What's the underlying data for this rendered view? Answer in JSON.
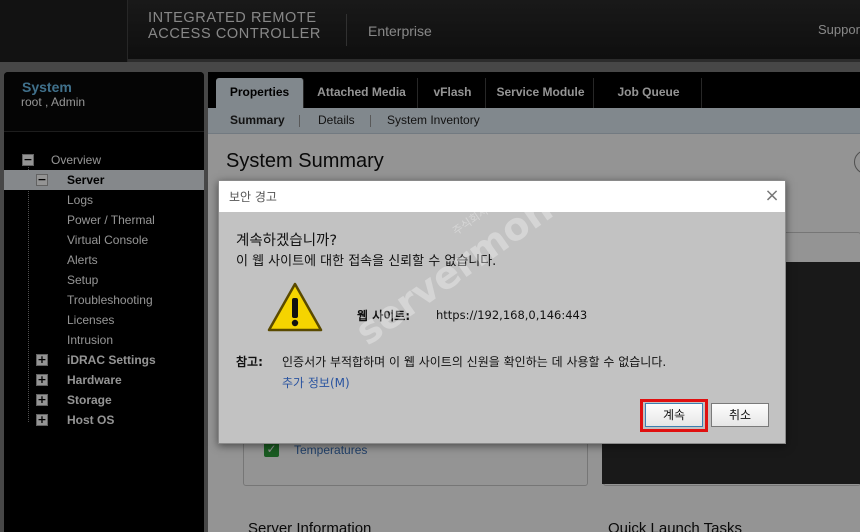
{
  "header": {
    "brand_line1": "INTEGRATED REMOTE",
    "brand_line2": "ACCESS CONTROLLER",
    "edition": "Enterprise",
    "support": "Support"
  },
  "sidebar": {
    "title": "System",
    "user": "root , Admin",
    "tree": [
      {
        "label": "Overview",
        "toggle": "−"
      },
      {
        "label": "Server",
        "toggle": "−"
      },
      {
        "label": "Logs"
      },
      {
        "label": "Power / Thermal"
      },
      {
        "label": "Virtual Console"
      },
      {
        "label": "Alerts"
      },
      {
        "label": "Setup"
      },
      {
        "label": "Troubleshooting"
      },
      {
        "label": "Licenses"
      },
      {
        "label": "Intrusion"
      },
      {
        "label": "iDRAC Settings",
        "toggle": "+"
      },
      {
        "label": "Hardware",
        "toggle": "+"
      },
      {
        "label": "Storage",
        "toggle": "+"
      },
      {
        "label": "Host OS",
        "toggle": "+"
      }
    ]
  },
  "tabs": [
    "Properties",
    "Attached Media",
    "vFlash",
    "Service Module",
    "Job Queue"
  ],
  "subtabs": [
    "Summary",
    "Details",
    "System Inventory"
  ],
  "page": {
    "title": "System Summary",
    "temperatures_link": "Temperatures",
    "server_info": "Server Information",
    "quick_launch": "Quick Launch Tasks"
  },
  "dialog": {
    "title": "보안 경고",
    "close": "×",
    "heading": "계속하겠습니까?",
    "description": "이 웹 사이트에 대한 접속을 신뢰할 수 없습니다.",
    "site_label": "웹 사이트:",
    "site_value": "https://192,168,0,146:443",
    "note_label": "참고:",
    "note_text": "인증서가 부적합하며 이 웹 사이트의 신원을 확인하는 데 사용할 수 없습니다.",
    "more_info": "추가 정보(M)",
    "continue_button": "계속",
    "cancel_button": "취소"
  },
  "watermark": {
    "text": "servermon",
    "sub": "주식회사서버몬"
  },
  "colors": {
    "accent_blue": "#6ec2f0",
    "highlight_red": "#e01010",
    "link_blue": "#2a54a0"
  }
}
